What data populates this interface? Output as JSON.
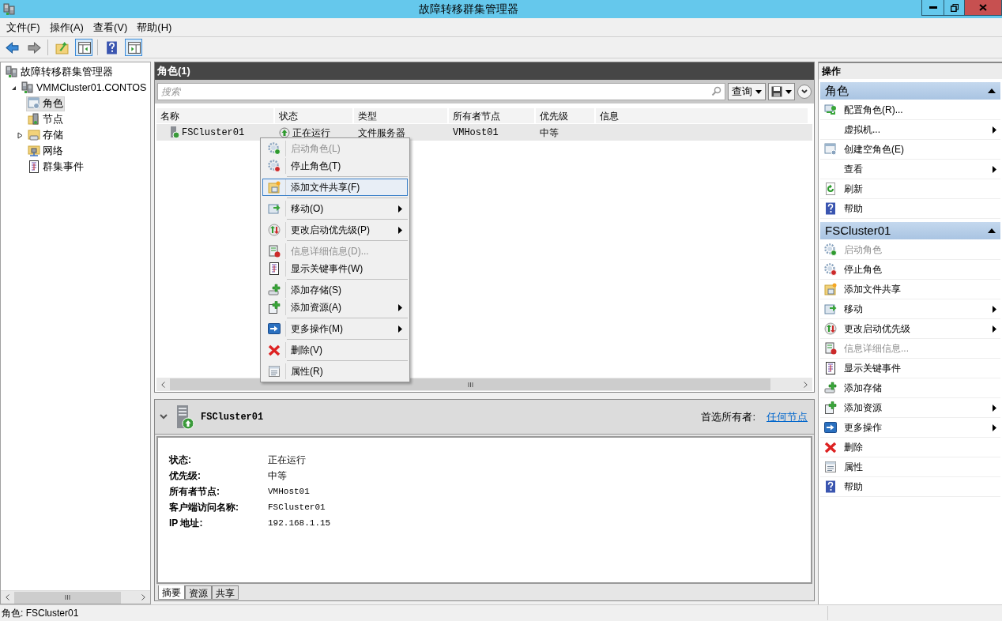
{
  "window": {
    "title": "故障转移群集管理器"
  },
  "menu_bar": [
    "文件(F)",
    "操作(A)",
    "查看(V)",
    "帮助(H)"
  ],
  "tree": [
    {
      "label": "故障转移群集管理器",
      "kind": "cluster",
      "selected": false,
      "children": [
        {
          "label": "VMMCluster01.CONTOS",
          "kind": "cluster",
          "selected": false,
          "expanded": true,
          "children": [
            {
              "label": "角色",
              "kind": "roles",
              "selected": true
            },
            {
              "label": "节点",
              "kind": "nodes",
              "selected": false
            },
            {
              "label": "存储",
              "kind": "storage",
              "selected": false,
              "expanded": false
            },
            {
              "label": "网络",
              "kind": "network",
              "selected": false
            },
            {
              "label": "群集事件",
              "kind": "events",
              "selected": false
            }
          ]
        }
      ]
    }
  ],
  "roles": {
    "title": "角色(1)",
    "search": {
      "placeholder": "搜索"
    },
    "query_button": "查询",
    "columns": [
      "名称",
      "状态",
      "类型",
      "所有者节点",
      "优先级",
      "信息"
    ],
    "rows": [
      {
        "selected": true,
        "cells": [
          "FSCluster01",
          "正在运行",
          "文件服务器",
          "VMHost01",
          "中等",
          ""
        ]
      }
    ]
  },
  "context_menu": [
    [
      {
        "label": "启动角色(L)",
        "kind": "start",
        "disabled": true,
        "selected": false,
        "submenu": false
      },
      {
        "label": "停止角色(T)",
        "kind": "stop",
        "disabled": false,
        "selected": false,
        "submenu": false
      }
    ],
    [
      {
        "label": "添加文件共享(F)",
        "kind": "share",
        "disabled": false,
        "selected": true,
        "submenu": false
      }
    ],
    [
      {
        "label": "移动(O)",
        "kind": "move",
        "disabled": false,
        "selected": false,
        "submenu": true
      }
    ],
    [
      {
        "label": "更改启动优先级(P)",
        "kind": "priority",
        "disabled": false,
        "selected": false,
        "submenu": true
      }
    ],
    [
      {
        "label": "信息详细信息(D)...",
        "kind": "info",
        "disabled": true,
        "selected": false,
        "submenu": false
      },
      {
        "label": "显示关键事件(W)",
        "kind": "events",
        "disabled": false,
        "selected": false,
        "submenu": false
      }
    ],
    [
      {
        "label": "添加存储(S)",
        "kind": "add-storage",
        "disabled": false,
        "selected": false,
        "submenu": false
      },
      {
        "label": "添加资源(A)",
        "kind": "add-resource",
        "disabled": false,
        "selected": false,
        "submenu": true
      }
    ],
    [
      {
        "label": "更多操作(M)",
        "kind": "more",
        "disabled": false,
        "selected": false,
        "submenu": true
      }
    ],
    [
      {
        "label": "删除(V)",
        "kind": "delete",
        "disabled": false,
        "selected": false,
        "submenu": false
      }
    ],
    [
      {
        "label": "属性(R)",
        "kind": "properties",
        "disabled": false,
        "selected": false,
        "submenu": false
      }
    ]
  ],
  "details": {
    "title": "FSCluster01",
    "preferred_owners_label": "首选所有者:",
    "preferred_owners_link": "任何节点",
    "fields": [
      {
        "label": "状态:",
        "value": "正在运行"
      },
      {
        "label": "优先级:",
        "value": "中等"
      },
      {
        "label": "所有者节点:",
        "value": "VMHost01"
      },
      {
        "label": "客户端访问名称:",
        "value": "FSCluster01"
      },
      {
        "label": "IP 地址:",
        "value": "192.168.1.15"
      }
    ],
    "tabs": [
      {
        "label": "摘要",
        "selected": true
      },
      {
        "label": "资源",
        "selected": false
      },
      {
        "label": "共享",
        "selected": false
      }
    ]
  },
  "actions": {
    "title": "操作",
    "sections": [
      {
        "title": "角色",
        "expanded": true,
        "items": [
          {
            "label": "配置角色(R)...",
            "kind": "configure",
            "disabled": false,
            "submenu": false
          },
          {
            "label": "虚拟机...",
            "kind": "none",
            "disabled": false,
            "submenu": true
          },
          {
            "label": "创建空角色(E)",
            "kind": "empty-role",
            "disabled": false,
            "submenu": false
          },
          {
            "label": "查看",
            "kind": "none",
            "disabled": false,
            "submenu": true
          },
          {
            "label": "刷新",
            "kind": "refresh",
            "disabled": false,
            "submenu": false
          },
          {
            "label": "帮助",
            "kind": "help",
            "disabled": false,
            "submenu": false
          }
        ]
      },
      {
        "title": "FSCluster01",
        "expanded": true,
        "items": [
          {
            "label": "启动角色",
            "kind": "start",
            "disabled": true,
            "submenu": false
          },
          {
            "label": "停止角色",
            "kind": "stop",
            "disabled": false,
            "submenu": false
          },
          {
            "label": "添加文件共享",
            "kind": "share",
            "disabled": false,
            "submenu": false
          },
          {
            "label": "移动",
            "kind": "move",
            "disabled": false,
            "submenu": true
          },
          {
            "label": "更改启动优先级",
            "kind": "priority",
            "disabled": false,
            "submenu": true
          },
          {
            "label": "信息详细信息...",
            "kind": "info",
            "disabled": true,
            "submenu": false
          },
          {
            "label": "显示关键事件",
            "kind": "events",
            "disabled": false,
            "submenu": false
          },
          {
            "label": "添加存储",
            "kind": "add-storage",
            "disabled": false,
            "submenu": false
          },
          {
            "label": "添加资源",
            "kind": "add-resource",
            "disabled": false,
            "submenu": true
          },
          {
            "label": "更多操作",
            "kind": "more",
            "disabled": false,
            "submenu": true
          },
          {
            "label": "删除",
            "kind": "delete",
            "disabled": false,
            "submenu": false
          },
          {
            "label": "属性",
            "kind": "properties",
            "disabled": false,
            "submenu": false
          },
          {
            "label": "帮助",
            "kind": "help",
            "disabled": false,
            "submenu": false
          }
        ]
      }
    ]
  },
  "status_bar": "角色: FSCluster01"
}
